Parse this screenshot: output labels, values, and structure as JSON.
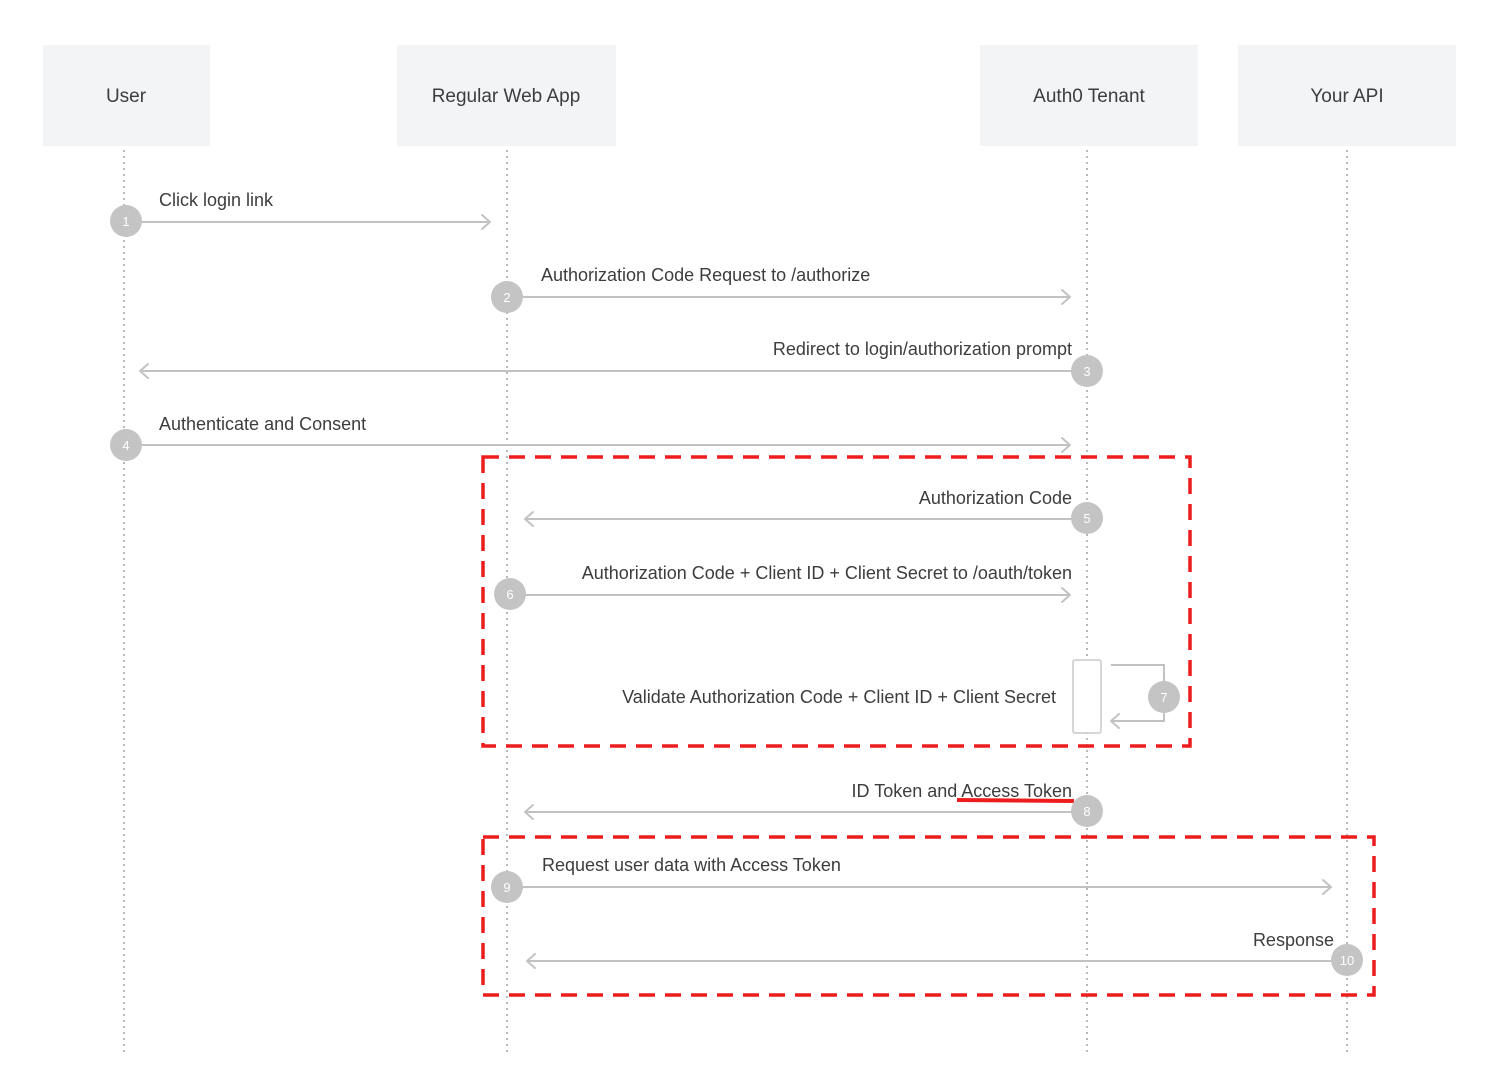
{
  "actors": [
    {
      "id": "user",
      "label": "User"
    },
    {
      "id": "webapp",
      "label": "Regular Web App"
    },
    {
      "id": "auth0",
      "label": "Auth0 Tenant"
    },
    {
      "id": "api",
      "label": "Your API"
    }
  ],
  "messages": [
    {
      "step": "1",
      "label": "Click login link",
      "from": "user",
      "to": "webapp"
    },
    {
      "step": "2",
      "label": "Authorization Code Request to /authorize",
      "from": "webapp",
      "to": "auth0"
    },
    {
      "step": "3",
      "label": "Redirect to login/authorization prompt",
      "from": "auth0",
      "to": "user"
    },
    {
      "step": "4",
      "label": "Authenticate and Consent",
      "from": "user",
      "to": "auth0"
    },
    {
      "step": "5",
      "label": "Authorization Code",
      "from": "auth0",
      "to": "webapp"
    },
    {
      "step": "6",
      "label": "Authorization Code + Client ID + Client Secret to /oauth/token",
      "from": "webapp",
      "to": "auth0"
    },
    {
      "step": "7",
      "label": "Validate Authorization Code + Client ID + Client Secret",
      "from": "auth0",
      "to": "auth0"
    },
    {
      "step": "8",
      "label": "ID Token and Access Token",
      "from": "auth0",
      "to": "webapp"
    },
    {
      "step": "9",
      "label": "Request user data with Access Token",
      "from": "webapp",
      "to": "api"
    },
    {
      "step": "10",
      "label": "Response",
      "from": "api",
      "to": "webapp"
    }
  ],
  "highlights": {
    "box_steps": [
      [
        "5",
        "6",
        "7"
      ],
      [
        "9",
        "10"
      ]
    ],
    "underlined_phrase": "Access Token",
    "underlined_step": "8",
    "color": "#ee1d1d"
  },
  "colors": {
    "actor_fill": "#f2f4f6",
    "arrow": "#c2c2c2",
    "step_circle": "#c4c4c4",
    "text": "#3d3d3d"
  }
}
